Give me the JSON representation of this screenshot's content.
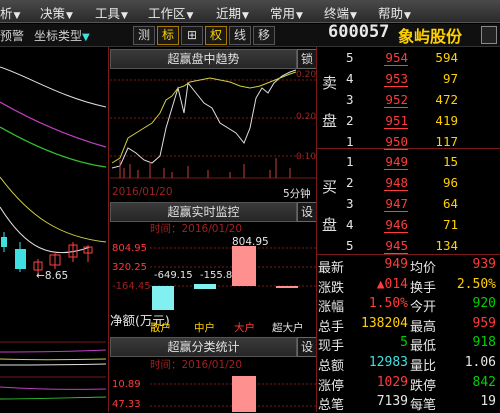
{
  "menu": [
    {
      "label": "析",
      "arrow": "▼"
    },
    {
      "label": "决策",
      "arrow": "▼"
    },
    {
      "label": "工具",
      "arrow": "▼"
    },
    {
      "label": "工作区",
      "arrow": "▼"
    },
    {
      "label": "近期",
      "arrow": "▼"
    },
    {
      "label": "常用",
      "arrow": "▼"
    },
    {
      "label": "终端",
      "arrow": "▼"
    },
    {
      "label": "帮助",
      "arrow": "▼"
    }
  ],
  "toolbar": {
    "alert": "预警",
    "axis_type": "坐标类型",
    "axis_arrow": "▼",
    "buttons": [
      "测",
      "标",
      "⊞",
      "权",
      "线",
      "移"
    ],
    "active_buttons": [
      "标",
      "权"
    ],
    "stock_code": "600057",
    "stock_name": "象屿股份"
  },
  "panels": {
    "intraday": {
      "title": "超赢盘中趋势",
      "lock": "锁",
      "date": "2016/01/20",
      "period": "5分钟",
      "axis_right": [
        "0.20",
        "0.20",
        "0.20",
        "0.10"
      ]
    },
    "monitor": {
      "title": "超赢实时监控",
      "set": "设",
      "time_label": "时间：2016/01/20",
      "yticks": [
        "804.95",
        "320.25",
        "-164.45",
        "-649.15"
      ],
      "bar_top_label": "804.95",
      "bar_labels": [
        "-649.15",
        "-155.8"
      ],
      "net_label": "净额(万元)",
      "categories": [
        "散户",
        "中户",
        "大户",
        "超大户"
      ]
    },
    "stats": {
      "title": "超赢分类统计",
      "set": "设",
      "time_label": "时间：2016/01/20",
      "yticks": [
        "10.89",
        "47.33"
      ]
    }
  },
  "left_chart": {
    "price_label": "8.65",
    "arrow": "←"
  },
  "orderbook": {
    "sell_label": [
      "卖",
      "盘"
    ],
    "buy_label": [
      "买",
      "盘"
    ],
    "sell": [
      {
        "level": "5",
        "price": "954",
        "vol": "594"
      },
      {
        "level": "4",
        "price": "953",
        "vol": "97"
      },
      {
        "level": "3",
        "price": "952",
        "vol": "472"
      },
      {
        "level": "2",
        "price": "951",
        "vol": "419"
      },
      {
        "level": "1",
        "price": "950",
        "vol": "117"
      }
    ],
    "buy": [
      {
        "level": "1",
        "price": "949",
        "vol": "15"
      },
      {
        "level": "2",
        "price": "948",
        "vol": "96"
      },
      {
        "level": "3",
        "price": "947",
        "vol": "64"
      },
      {
        "level": "4",
        "price": "946",
        "vol": "71"
      },
      {
        "level": "5",
        "price": "945",
        "vol": "134"
      }
    ]
  },
  "quote": [
    {
      "l1": "最新",
      "v1": "949",
      "l2": "均价",
      "v2": "939",
      "c1": "red",
      "c2": "red"
    },
    {
      "l1": "涨跌",
      "v1": "▲014",
      "l2": "换手",
      "v2": "2.50%",
      "c1": "red",
      "c2": "yellow"
    },
    {
      "l1": "涨幅",
      "v1": "1.50%",
      "l2": "今开",
      "v2": "920",
      "c1": "red",
      "c2": "green"
    },
    {
      "l1": "总手",
      "v1": "138204",
      "l2": "最高",
      "v2": "959",
      "c1": "yellow",
      "c2": "red"
    },
    {
      "l1": "现手",
      "v1": "5",
      "l2": "最低",
      "v2": "918",
      "c1": "green",
      "c2": "green"
    },
    {
      "l1": "总额",
      "v1": "12983",
      "l2": "量比",
      "v2": "1.06",
      "c1": "cyan",
      "c2": "white"
    },
    {
      "l1": "涨停",
      "v1": "1029",
      "l2": "跌停",
      "v2": "842",
      "c1": "red",
      "c2": "green"
    },
    {
      "l1": "总笔",
      "v1": "7139",
      "l2": "每笔",
      "v2": "19",
      "c1": "white",
      "c2": "white"
    }
  ]
}
